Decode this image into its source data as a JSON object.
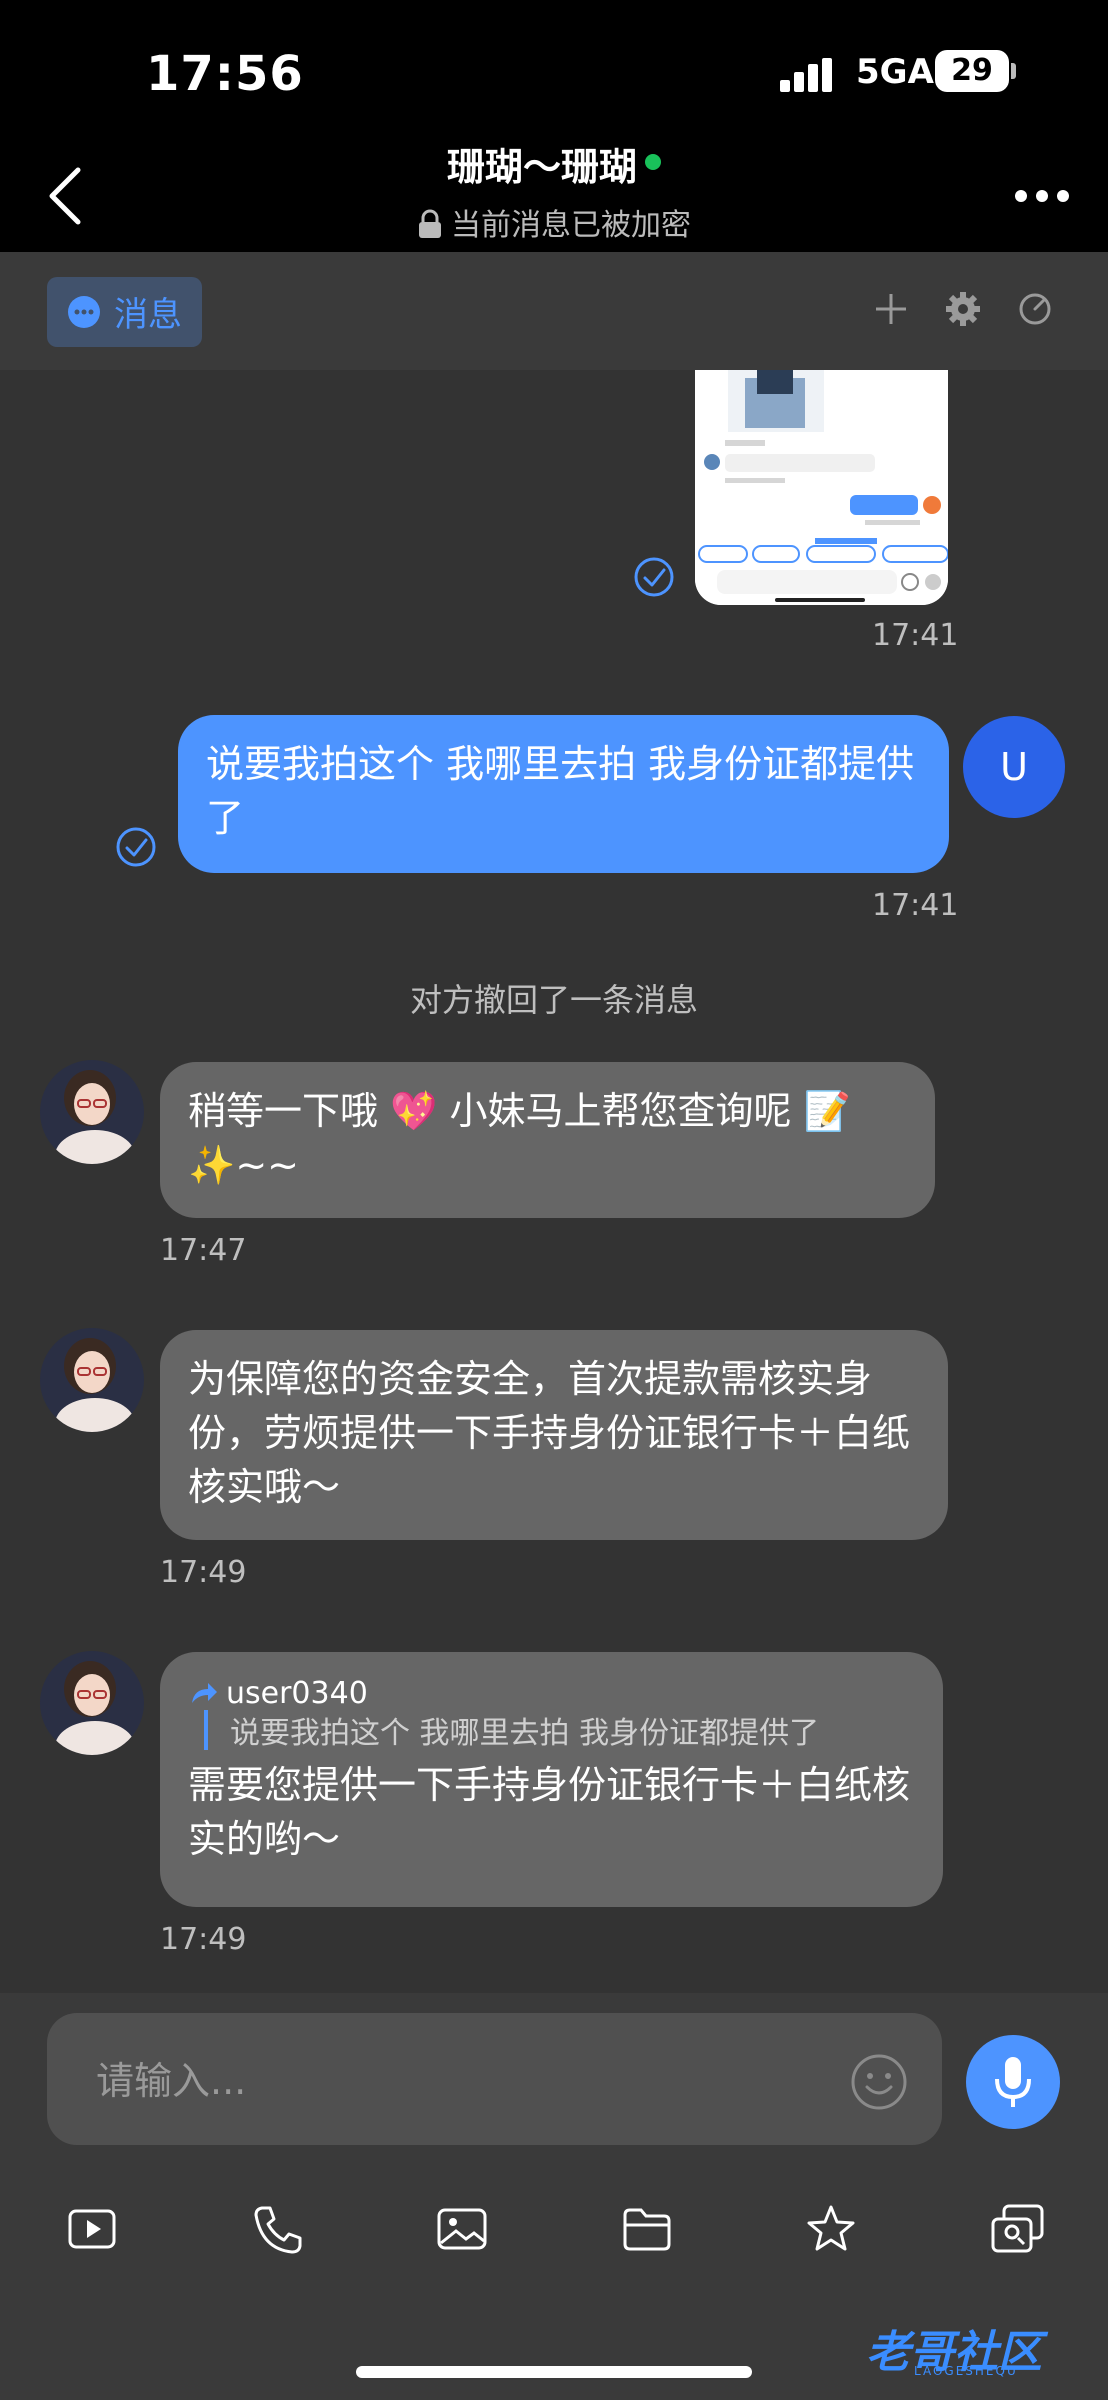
{
  "status_bar": {
    "time": "17:56",
    "network": "5GA",
    "battery": "29"
  },
  "header": {
    "title": "珊瑚～珊瑚",
    "subtitle": "当前消息已被加密"
  },
  "toolbar": {
    "tab_label": "消息"
  },
  "messages": {
    "image_time": "17:41",
    "sent_text": "说要我拍这个 我哪里去拍 我身份证都提供了",
    "sent_time": "17:41",
    "user_initial": "U",
    "recall_notice": "对方撤回了一条消息",
    "recv1_text_a": "稍等一下哦 💖 小妹马上帮您查询呢 📝",
    "recv1_text_b": "✨~~",
    "recv1_time": "17:47",
    "recv2_text": "为保障您的资金安全，首次提款需核实身份，劳烦提供一下手持身份证银行卡＋白纸核实哦～",
    "recv2_time": "17:49",
    "recv3_quote_name": "user0340",
    "recv3_quote_text": "说要我拍这个 我哪里去拍 我身份证都提供了",
    "recv3_text": "需要您提供一下手持身份证银行卡＋白纸核实的哟～",
    "recv3_time": "17:49"
  },
  "input": {
    "placeholder": "请输入..."
  },
  "bottom_tools": [
    "video-icon",
    "phone-icon",
    "image-icon",
    "folder-icon",
    "star-icon",
    "contact-card-icon"
  ],
  "watermark": {
    "text": "老哥社区",
    "sub": "LAOGESHEQU"
  },
  "colors": {
    "accent": "#4d94ff",
    "online": "#19c15a",
    "bubble_recv": "#666666"
  }
}
